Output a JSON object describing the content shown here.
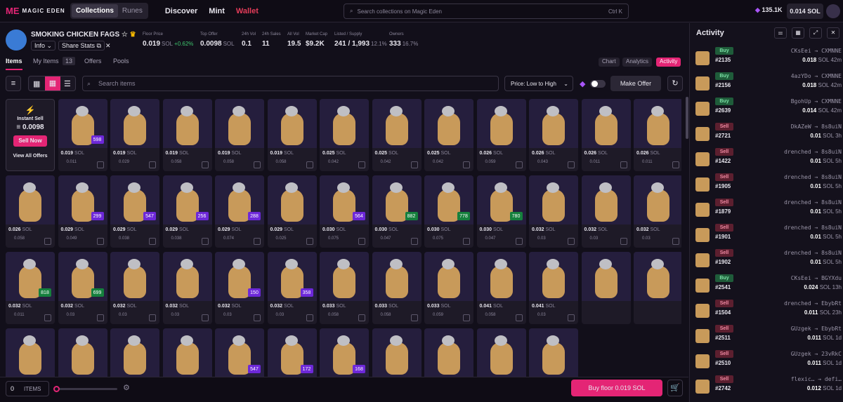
{
  "nav": {
    "brand": "MAGIC EDEN",
    "seg": [
      "Collections",
      "Runes"
    ],
    "links": [
      "Discover",
      "Mint",
      "Wallet"
    ],
    "search_placeholder": "Search collections on Magic Eden",
    "search_shortcut": "Ctrl K",
    "points": "135.1K",
    "balance": "0.014 SOL"
  },
  "collection": {
    "name": "SMOKING CHICKEN FAGS",
    "info_label": "Info",
    "share_label": "Share Stats",
    "stats": [
      {
        "label": "Floor Price",
        "value": "0.019",
        "unit": "SOL",
        "extra": "+0.62%"
      },
      {
        "label": "Top Offer",
        "value": "0.0098",
        "unit": "SOL",
        "extra": ""
      },
      {
        "label": "24h Vol",
        "value": "0.1",
        "unit": "",
        "extra": ""
      },
      {
        "label": "24h Sales",
        "value": "11",
        "unit": "",
        "extra": ""
      },
      {
        "label": "All Vol",
        "value": "19.5",
        "unit": "",
        "extra": ""
      },
      {
        "label": "Market Cap",
        "value": "$9.2K",
        "unit": "",
        "extra": ""
      },
      {
        "label": "Listed / Supply",
        "value": "241 / 1,993",
        "unit": "",
        "extra": "12.1%"
      },
      {
        "label": "Owners",
        "value": "333",
        "unit": "",
        "extra": "16.7%"
      }
    ]
  },
  "tabs": {
    "left": [
      "Items",
      "My Items",
      "Offers",
      "Pools"
    ],
    "my_items_count": "13",
    "right": [
      "Chart",
      "Analytics",
      "Activity"
    ]
  },
  "toolbar": {
    "search_placeholder": "Search items",
    "sort": "Price: Low to High",
    "make_offer": "Make Offer"
  },
  "instant": {
    "title": "Instant Sell",
    "price": "0.0098",
    "sell_now": "Sell Now",
    "view_all": "View All Offers"
  },
  "items": [
    {
      "price": "0.019",
      "offer": "0.011",
      "badge": "598",
      "bc": "#6d28d9"
    },
    {
      "price": "0.019",
      "offer": "0.029",
      "badge": "",
      "bc": ""
    },
    {
      "price": "0.019",
      "offer": "0.058",
      "badge": "",
      "bc": ""
    },
    {
      "price": "0.019",
      "offer": "0.058",
      "badge": "",
      "bc": ""
    },
    {
      "price": "0.019",
      "offer": "0.058",
      "badge": "",
      "bc": ""
    },
    {
      "price": "0.025",
      "offer": "0.042",
      "badge": "",
      "bc": ""
    },
    {
      "price": "0.025",
      "offer": "0.042",
      "badge": "",
      "bc": ""
    },
    {
      "price": "0.025",
      "offer": "0.042",
      "badge": "",
      "bc": ""
    },
    {
      "price": "0.026",
      "offer": "0.059",
      "badge": "",
      "bc": ""
    },
    {
      "price": "0.026",
      "offer": "0.043",
      "badge": "",
      "bc": ""
    },
    {
      "price": "0.026",
      "offer": "0.011",
      "badge": "",
      "bc": ""
    },
    {
      "price": "0.026",
      "offer": "0.011",
      "badge": "",
      "bc": ""
    },
    {
      "price": "0.026",
      "offer": "0.058",
      "badge": "",
      "bc": ""
    },
    {
      "price": "0.029",
      "offer": "0.049",
      "badge": "299",
      "bc": "#6d28d9"
    },
    {
      "price": "0.029",
      "offer": "0.038",
      "badge": "547",
      "bc": "#6d28d9"
    },
    {
      "price": "0.029",
      "offer": "0.038",
      "badge": "256",
      "bc": "#6d28d9"
    },
    {
      "price": "0.029",
      "offer": "0.074",
      "badge": "288",
      "bc": "#6d28d9"
    },
    {
      "price": "0.029",
      "offer": "0.025",
      "badge": "",
      "bc": ""
    },
    {
      "price": "0.030",
      "offer": "0.075",
      "badge": "564",
      "bc": "#6d28d9"
    },
    {
      "price": "0.030",
      "offer": "0.047",
      "badge": "882",
      "bc": "#15803d"
    },
    {
      "price": "0.030",
      "offer": "0.075",
      "badge": "778",
      "bc": "#15803d"
    },
    {
      "price": "0.030",
      "offer": "0.047",
      "badge": "780",
      "bc": "#15803d"
    },
    {
      "price": "0.032",
      "offer": "0.03",
      "badge": "",
      "bc": ""
    },
    {
      "price": "0.032",
      "offer": "0.03",
      "badge": "",
      "bc": ""
    },
    {
      "price": "0.032",
      "offer": "0.03",
      "badge": "",
      "bc": ""
    },
    {
      "price": "0.032",
      "offer": "0.011",
      "badge": "818",
      "bc": "#15803d"
    },
    {
      "price": "0.032",
      "offer": "0.03",
      "badge": "699",
      "bc": "#15803d"
    },
    {
      "price": "0.032",
      "offer": "0.03",
      "badge": "",
      "bc": ""
    },
    {
      "price": "0.032",
      "offer": "0.03",
      "badge": "",
      "bc": ""
    },
    {
      "price": "0.032",
      "offer": "0.03",
      "badge": "150",
      "bc": "#6d28d9"
    },
    {
      "price": "0.032",
      "offer": "0.03",
      "badge": "358",
      "bc": "#6d28d9"
    },
    {
      "price": "0.033",
      "offer": "0.058",
      "badge": "",
      "bc": ""
    },
    {
      "price": "0.033",
      "offer": "0.058",
      "badge": "",
      "bc": ""
    },
    {
      "price": "0.033",
      "offer": "0.059",
      "badge": "",
      "bc": ""
    },
    {
      "price": "0.041",
      "offer": "0.058",
      "badge": "",
      "bc": ""
    },
    {
      "price": "0.041",
      "offer": "0.03",
      "badge": "",
      "bc": ""
    },
    {
      "price": "",
      "offer": "",
      "badge": "",
      "bc": ""
    },
    {
      "price": "",
      "offer": "",
      "badge": "",
      "bc": ""
    },
    {
      "price": "",
      "offer": "",
      "badge": "",
      "bc": ""
    },
    {
      "price": "",
      "offer": "",
      "badge": "",
      "bc": ""
    },
    {
      "price": "",
      "offer": "",
      "badge": "",
      "bc": ""
    },
    {
      "price": "",
      "offer": "",
      "badge": "",
      "bc": ""
    },
    {
      "price": "",
      "offer": "",
      "badge": "547",
      "bc": "#6d28d9"
    },
    {
      "price": "",
      "offer": "",
      "badge": "172",
      "bc": "#6d28d9"
    },
    {
      "price": "",
      "offer": "",
      "badge": "168",
      "bc": "#6d28d9"
    },
    {
      "price": "",
      "offer": "",
      "badge": "",
      "bc": ""
    },
    {
      "price": "",
      "offer": "",
      "badge": "",
      "bc": ""
    },
    {
      "price": "",
      "offer": "",
      "badge": "",
      "bc": ""
    },
    {
      "price": "",
      "offer": "",
      "badge": "",
      "bc": ""
    }
  ],
  "bottom": {
    "count": "0",
    "items_label": "ITEMS",
    "buy_floor": "Buy floor 0.019 SOL"
  },
  "activity": {
    "title": "Activity",
    "rows": [
      {
        "type": "Buy",
        "num": "#2135",
        "from": "CKsEei",
        "to": "CXMNNE",
        "price": "0.018",
        "time": "42m"
      },
      {
        "type": "Buy",
        "num": "#2156",
        "from": "4azYDo",
        "to": "CXMNNE",
        "price": "0.018",
        "time": "42m"
      },
      {
        "type": "Buy",
        "num": "#2639",
        "from": "BgohUp",
        "to": "CXMNNE",
        "price": "0.014",
        "time": "42m"
      },
      {
        "type": "Sell",
        "num": "#2721",
        "from": "DkAZeW",
        "to": "8s8uiN",
        "price": "0.01",
        "time": "3h"
      },
      {
        "type": "Sell",
        "num": "#1422",
        "from": "drenched",
        "to": "8s8uiN",
        "price": "0.01",
        "time": "5h"
      },
      {
        "type": "Sell",
        "num": "#1905",
        "from": "drenched",
        "to": "8s8uiN",
        "price": "0.01",
        "time": "5h"
      },
      {
        "type": "Sell",
        "num": "#1879",
        "from": "drenched",
        "to": "8s8uiN",
        "price": "0.01",
        "time": "5h"
      },
      {
        "type": "Sell",
        "num": "#1901",
        "from": "drenched",
        "to": "8s8uiN",
        "price": "0.01",
        "time": "5h"
      },
      {
        "type": "Sell",
        "num": "#1902",
        "from": "drenched",
        "to": "8s8uiN",
        "price": "0.01",
        "time": "5h"
      },
      {
        "type": "Buy",
        "num": "#2541",
        "from": "CKsEei",
        "to": "BGYXdu",
        "price": "0.024",
        "time": "13h"
      },
      {
        "type": "Sell",
        "num": "#1504",
        "from": "drenched",
        "to": "EbybRt",
        "price": "0.011",
        "time": "23h"
      },
      {
        "type": "Sell",
        "num": "#2511",
        "from": "GUzgek",
        "to": "EbybRt",
        "price": "0.011",
        "time": "1d"
      },
      {
        "type": "Sell",
        "num": "#2510",
        "from": "GUzgek",
        "to": "23vRkC",
        "price": "0.011",
        "time": "1d"
      },
      {
        "type": "Sell",
        "num": "#2742",
        "from": "flexic…",
        "to": "defi…",
        "price": "0.012",
        "time": "1d"
      }
    ]
  },
  "unit_sol": "SOL"
}
